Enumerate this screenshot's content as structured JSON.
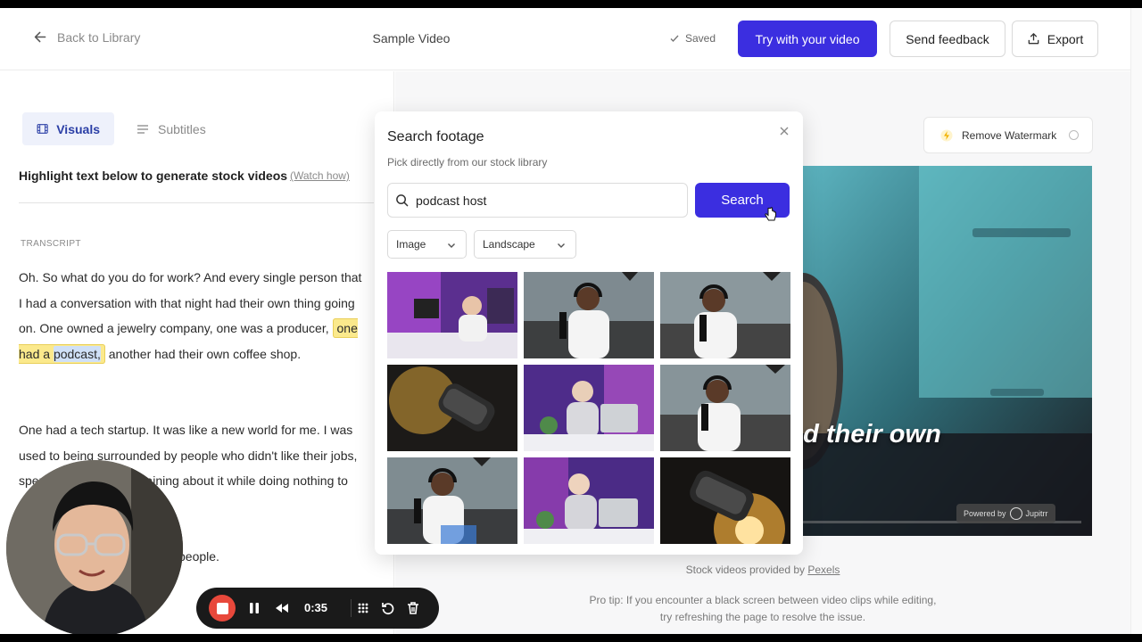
{
  "header": {
    "back_label": "Back to Library",
    "title": "Sample Video",
    "saved_label": "Saved",
    "try_label": "Try with your video",
    "feedback_label": "Send feedback",
    "export_label": "Export"
  },
  "left": {
    "tabs": [
      {
        "label": "Visuals",
        "active": true
      },
      {
        "label": "Subtitles",
        "active": false
      }
    ],
    "hint": "Highlight text below to generate stock videos",
    "watch_how": "(Watch how)",
    "transcript_label": "TRANSCRIPT",
    "p1_before": "Oh. So what do you do for work? And every single person that I had a conversation with that night had their own thing going on. One owned a jewelry company, one was a producer, ",
    "p1_hl_a": "one had a ",
    "p1_hl_b": "podcast,",
    "p1_after": " another had their own coffee shop.",
    "p2": "One had a tech startup. It was like a new world for me. I was used to being surrounded by people who didn't like their jobs, spending all day complaining about it while doing nothing to change their situation.",
    "p3": "people."
  },
  "search": {
    "title": "Search footage",
    "subtitle": "Pick directly from our stock library",
    "query": "podcast host",
    "button_label": "Search",
    "type_value": "Image",
    "orientation_value": "Landscape"
  },
  "preview": {
    "watermark_label": "Remove Watermark",
    "caption": "ad their own",
    "powered_by": "Powered by",
    "brand": "Jupitrr",
    "stock_note_prefix": "Stock videos provided by ",
    "stock_note_link": "Pexels",
    "pro_tip": "Pro tip: If you encounter a black screen between video clips while editing, try refreshing the page to resolve the issue."
  },
  "recorder": {
    "time": "0:35"
  },
  "colors": {
    "accent": "#3b2ee0",
    "highlight": "#fbe98c",
    "rec_red": "#e8483b"
  }
}
